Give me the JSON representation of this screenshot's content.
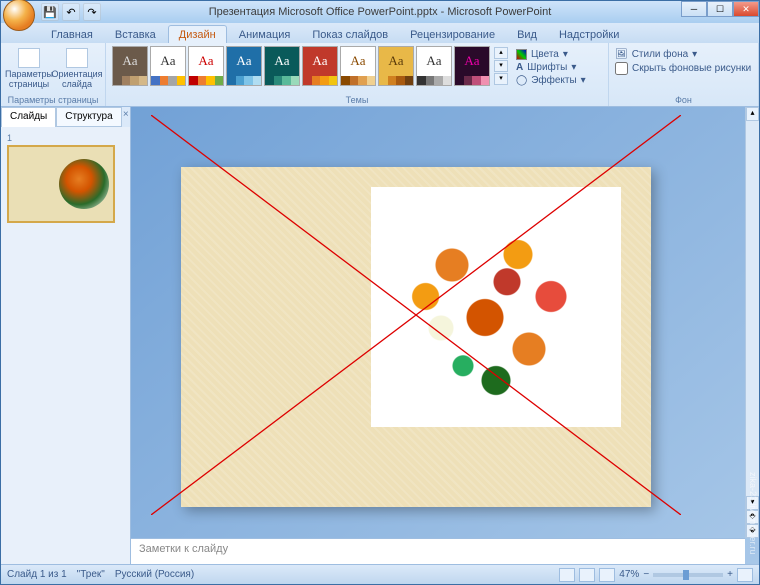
{
  "titlebar": {
    "title": "Презентация Microsoft Office PowerPoint.pptx - Microsoft PowerPoint"
  },
  "qat": {
    "save": "💾",
    "undo": "↶",
    "redo": "↷"
  },
  "tabs": {
    "items": [
      "Главная",
      "Вставка",
      "Дизайн",
      "Анимация",
      "Показ слайдов",
      "Рецензирование",
      "Вид",
      "Надстройки"
    ],
    "active_index": 2
  },
  "ribbon": {
    "group_setup": {
      "label": "Параметры страницы",
      "page_setup": "Параметры\nстраницы",
      "orientation": "Ориентация\nслайда"
    },
    "group_themes": {
      "label": "Темы",
      "aa": "Aa",
      "colors": "Цвета",
      "fonts": "Шрифты",
      "effects": "Эффекты"
    },
    "group_bg": {
      "label": "Фон",
      "styles": "Стили фона",
      "hide": "Скрыть фоновые рисунки"
    }
  },
  "left_panel": {
    "tab_slides": "Слайды",
    "tab_outline": "Структура",
    "slide_num": "1"
  },
  "notes": {
    "placeholder": "Заметки к слайду"
  },
  "status": {
    "slide_info": "Слайд 1 из 1",
    "theme": "\"Трек\"",
    "lang": "Русский (Россия)",
    "zoom": "47%"
  },
  "watermark": "zika-23  livemaster.ru",
  "themes": [
    {
      "bg": "#6b5a4a",
      "fg": "#ddd",
      "c": [
        "#6b5a4a",
        "#a08060",
        "#c0a070",
        "#d4b888"
      ]
    },
    {
      "bg": "#ffffff",
      "fg": "#333",
      "c": [
        "#4472c4",
        "#ed7d31",
        "#a5a5a5",
        "#ffc000"
      ]
    },
    {
      "bg": "#ffffff",
      "fg": "#c00",
      "c": [
        "#c00000",
        "#ed7d31",
        "#ffc000",
        "#70ad47"
      ]
    },
    {
      "bg": "#1f6fa8",
      "fg": "#fff",
      "c": [
        "#1f6fa8",
        "#4a9fd0",
        "#7fc4e8",
        "#b0ddf2"
      ]
    },
    {
      "bg": "#0a5a5a",
      "fg": "#fff",
      "c": [
        "#0a5a5a",
        "#2a8a7a",
        "#5aba9a",
        "#9adaba"
      ]
    },
    {
      "bg": "#c0392b",
      "fg": "#fff",
      "c": [
        "#c0392b",
        "#e67e22",
        "#f39c12",
        "#f1c40f"
      ]
    },
    {
      "bg": "#ffffff",
      "fg": "#8a4a00",
      "c": [
        "#8a4a00",
        "#c0702a",
        "#e0a050",
        "#f0d090"
      ]
    },
    {
      "bg": "#e8b848",
      "fg": "#5a3a0a",
      "c": [
        "#e8b848",
        "#d08020",
        "#a85a10",
        "#704010"
      ]
    },
    {
      "bg": "#ffffff",
      "fg": "#333",
      "c": [
        "#333",
        "#777",
        "#aaa",
        "#ddd"
      ]
    },
    {
      "bg": "#2a0a2a",
      "fg": "#e0a",
      "c": [
        "#2a0a2a",
        "#6a2a4a",
        "#c0507a",
        "#f090b0"
      ]
    }
  ]
}
